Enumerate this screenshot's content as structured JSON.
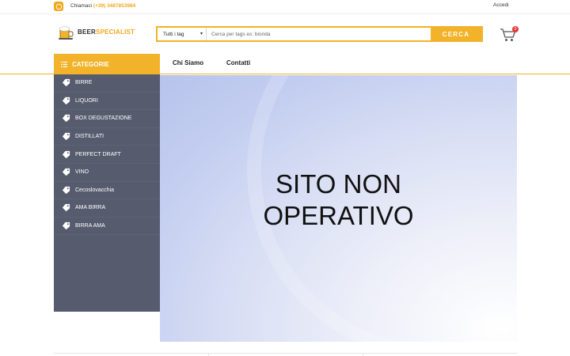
{
  "topbar": {
    "call_label": "Chiamaci",
    "phone": "(+39) 3487853984",
    "login_label": "Accedi"
  },
  "logo": {
    "part1": "BEER",
    "part2": "SPECIALIST"
  },
  "search": {
    "category_value": "Tutti i tag",
    "placeholder": "Cerca per tags es: bionda",
    "button_label": "CERCA"
  },
  "cart": {
    "count": "0"
  },
  "nav": {
    "categories_label": "CATEGORIE",
    "links": [
      "Chi Siamo",
      "Contatti"
    ]
  },
  "sidebar": {
    "items": [
      "BIRRE",
      "LIQUORI",
      "BOX DEGUSTAZIONE",
      "DISTILLATI",
      "PERFECT DRAFT",
      "VINO",
      "Cecoslovacchia",
      "AMA BIRRA",
      "BIRRA AMA"
    ]
  },
  "banner": {
    "line1": "SITO NON",
    "line2": "OPERATIVO"
  },
  "colors": {
    "accent": "#f2b229",
    "sidebar_bg": "#575b6e",
    "badge": "#e53935"
  },
  "icons": {
    "whatsapp": "whatsapp-icon",
    "cart": "cart-icon",
    "menu": "menu-icon",
    "category": "tag-icon"
  }
}
